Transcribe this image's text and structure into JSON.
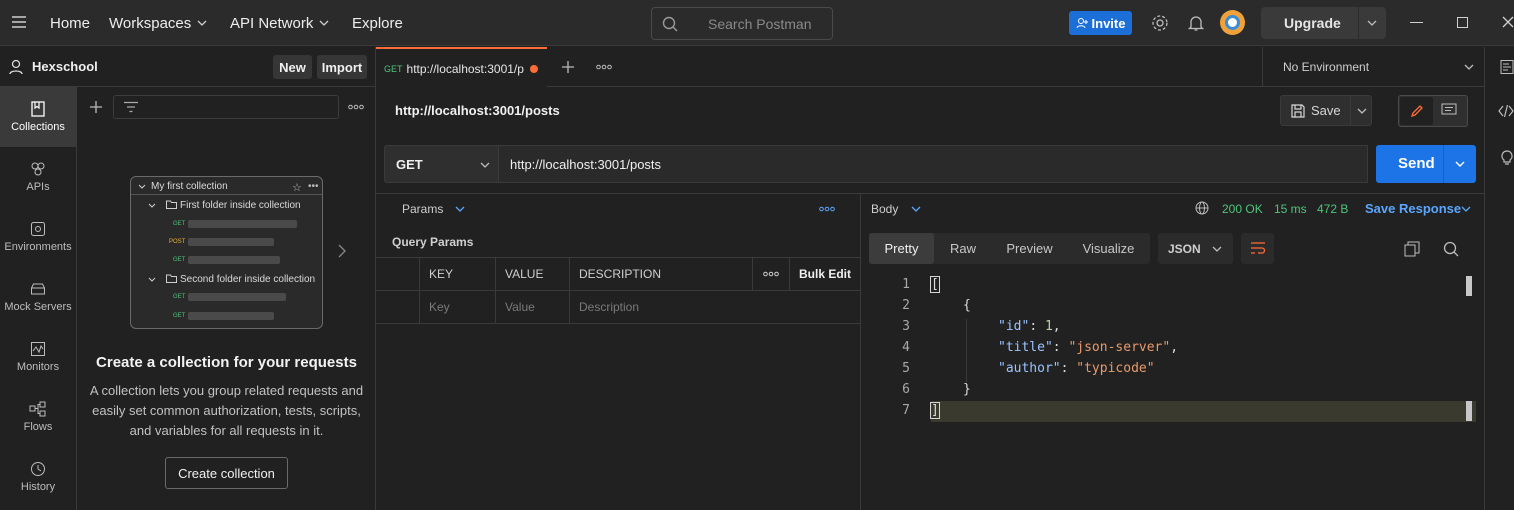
{
  "topbar": {
    "nav": {
      "home": "Home",
      "workspaces": "Workspaces",
      "api_network": "API Network",
      "explore": "Explore"
    },
    "search_placeholder": "Search Postman",
    "invite": "Invite",
    "upgrade": "Upgrade"
  },
  "workspace": {
    "name": "Hexschool",
    "new_label": "New",
    "import_label": "Import"
  },
  "rail": [
    {
      "label": "Collections",
      "icon": "collections-icon"
    },
    {
      "label": "APIs",
      "icon": "apis-icon"
    },
    {
      "label": "Environments",
      "icon": "environments-icon"
    },
    {
      "label": "Mock Servers",
      "icon": "mock-servers-icon"
    },
    {
      "label": "Monitors",
      "icon": "monitors-icon"
    },
    {
      "label": "Flows",
      "icon": "flows-icon"
    },
    {
      "label": "History",
      "icon": "history-icon"
    }
  ],
  "collections": {
    "preview": {
      "root": "My first collection",
      "folder1": "First folder inside collection",
      "folder2": "Second folder inside collection",
      "get": "GET",
      "post": "POST"
    },
    "empty_title": "Create a collection for your requests",
    "empty_desc_1": "A collection lets you group related requests and",
    "empty_desc_2": "easily set common authorization, tests, scripts,",
    "empty_desc_3": "and variables for all requests in it.",
    "create_button": "Create collection"
  },
  "tabs": [
    {
      "method": "GET",
      "title": "http://localhost:3001/p"
    }
  ],
  "environment": "No Environment",
  "request": {
    "title": "http://localhost:3001/posts",
    "save_label": "Save",
    "method": "GET",
    "url": "http://localhost:3001/posts",
    "send_label": "Send"
  },
  "params": {
    "tab_label": "Params",
    "section_title": "Query Params",
    "headers": {
      "key": "KEY",
      "value": "VALUE",
      "description": "DESCRIPTION",
      "bulk_edit": "Bulk Edit"
    },
    "placeholders": {
      "key": "Key",
      "value": "Value",
      "description": "Description"
    }
  },
  "response": {
    "body_label": "Body",
    "status": "200 OK",
    "time": "15 ms",
    "size": "472 B",
    "save_response": "Save Response",
    "view_tabs": [
      "Pretty",
      "Raw",
      "Preview",
      "Visualize"
    ],
    "format": "JSON",
    "line_numbers": [
      "1",
      "2",
      "3",
      "4",
      "5",
      "6",
      "7"
    ],
    "body": {
      "l1": "[",
      "l2": "{",
      "id_key": "\"id\"",
      "id_val": "1",
      "title_key": "\"title\"",
      "title_val": "\"json-server\"",
      "author_key": "\"author\"",
      "author_val": "\"typicode\"",
      "l6": "}",
      "l7": "]"
    }
  },
  "colors": {
    "accent": "#ff6c37",
    "send": "#1c74e6",
    "invite": "#1c6fd6",
    "status_ok": "#4fc47a"
  }
}
